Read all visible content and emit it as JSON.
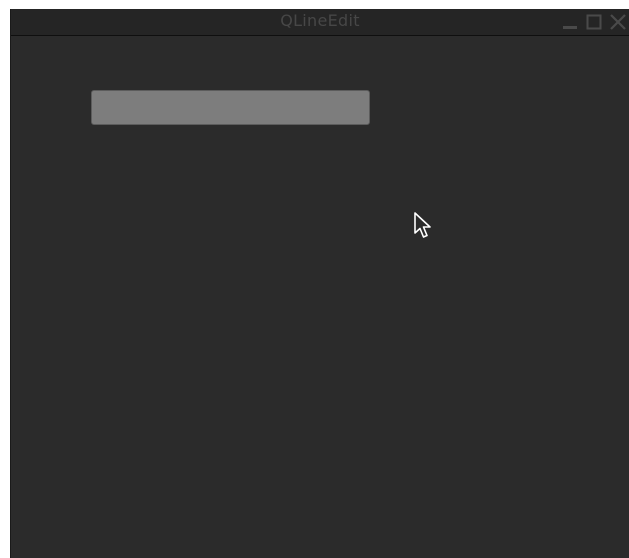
{
  "window": {
    "title": "QLineEdit",
    "controls": [
      "minimize-icon",
      "maximize-icon",
      "close-icon"
    ]
  },
  "line_edit": {
    "value": "",
    "placeholder": ""
  },
  "colors": {
    "background": "#2b2b2b",
    "titlebar": "#252525",
    "title_text": "#474747",
    "control_icons": "#4a4a4a",
    "line_edit_fill": "#7d7d7d"
  },
  "pointer": {
    "icon": "mouse-pointer-icon"
  }
}
